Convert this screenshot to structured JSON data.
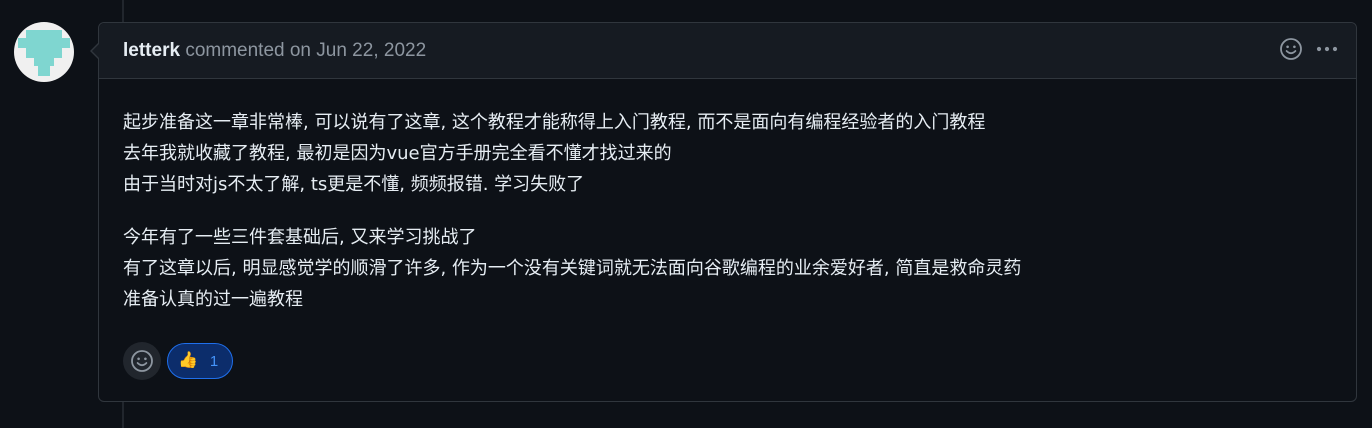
{
  "comment": {
    "author": "letterk",
    "meta": "commented on Jun 22, 2022",
    "paragraphs": [
      {
        "lines": [
          "起步准备这一章非常棒, 可以说有了这章, 这个教程才能称得上入门教程, 而不是面向有编程经验者的入门教程",
          "去年我就收藏了教程, 最初是因为vue官方手册完全看不懂才找过来的",
          "由于当时对js不太了解, ts更是不懂, 频频报错. 学习失败了"
        ]
      },
      {
        "lines": [
          "今年有了一些三件套基础后, 又来学习挑战了",
          "有了这章以后, 明显感觉学的顺滑了许多, 作为一个没有关键词就无法面向谷歌编程的业余爱好者, 简直是救命灵药",
          "准备认真的过一遍教程"
        ]
      }
    ],
    "reactions": [
      {
        "emoji": "👍",
        "icon": "thumbs-up-icon",
        "count": "1"
      }
    ],
    "header_icons": [
      "smiley-icon",
      "kebab-horizontal-icon"
    ]
  },
  "colors": {
    "background": "#0d1117",
    "header_bg": "#161b22",
    "border": "#30363d",
    "text": "#e6edf3",
    "muted": "#8d96a0",
    "accent": "#4493f8",
    "reaction_bg": "#0c2d6b",
    "reaction_border": "#1f6feb"
  }
}
